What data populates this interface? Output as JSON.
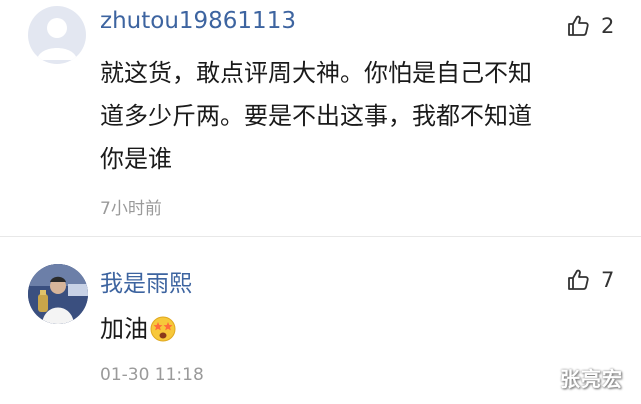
{
  "comments": [
    {
      "username": "zhutou19861113",
      "like_count": "2",
      "content_lines": [
        "就这货，敢点评周大神。你怕是自己不知",
        "道多少斤两。要是不出这事，我都不知道",
        "你是谁"
      ],
      "time": "7小时前",
      "avatar": "default-avatar-icon"
    },
    {
      "username": "我是雨熙",
      "like_count": "7",
      "content_text": "加油",
      "content_emoji": "star-eyes-emoji",
      "time": "01-30 11:18",
      "avatar": "user-photo-avatar"
    }
  ],
  "watermark": "张亮宏",
  "colors": {
    "username": "#3d64a0",
    "text": "#1a1a1a",
    "time": "#9a9a9a"
  }
}
